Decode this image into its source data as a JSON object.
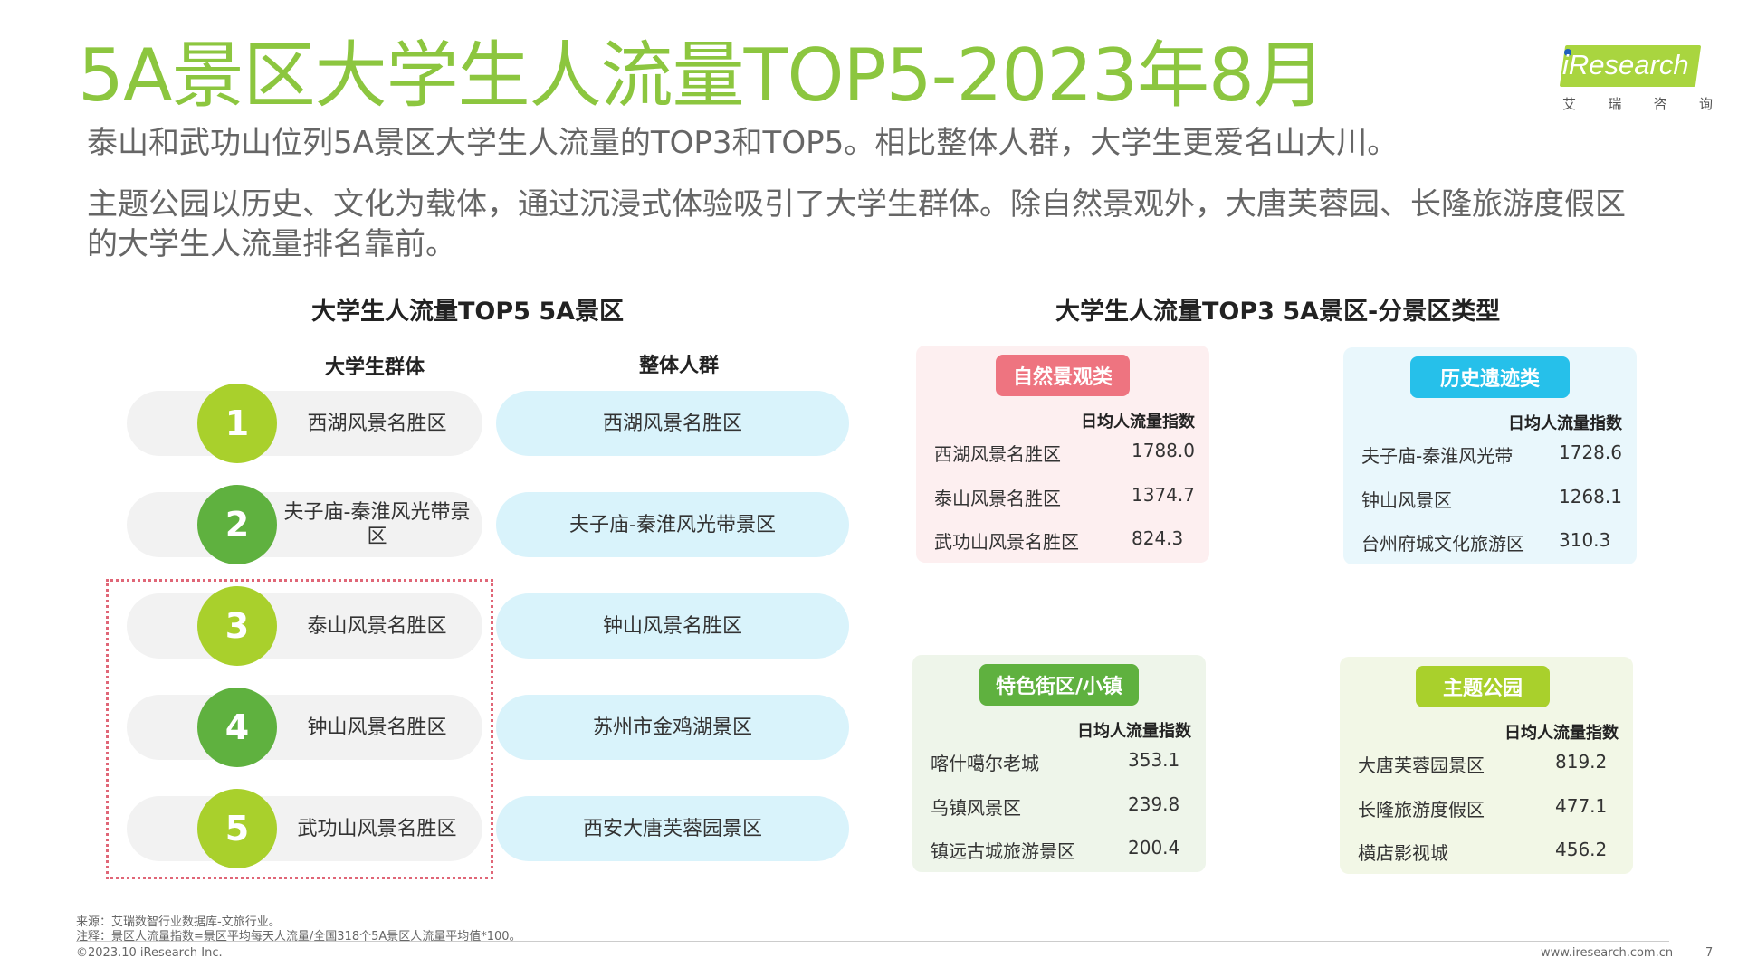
{
  "header": {
    "title": "5A景区大学生人流量TOP5-2023年8月",
    "subtitle_1": "泰山和武功山位列5A景区大学生人流量的TOP3和TOP5。相比整体人群，大学生更爱名山大川。",
    "subtitle_2": "主题公园以历史、文化为载体，通过沉浸式体验吸引了大学生群体。除自然景观外，大唐芙蓉园、长隆旅游度假区的大学生人流量排名靠前。"
  },
  "logo": {
    "text": "iResearch",
    "cn": [
      "艾",
      "瑞",
      "咨",
      "询"
    ]
  },
  "left": {
    "heading": "大学生人流量TOP5 5A景区",
    "col_students": "大学生群体",
    "col_overall": "整体人群",
    "ranks": [
      {
        "rank": "1",
        "student": "西湖风景名胜区",
        "overall": "西湖风景名胜区",
        "color": "#a9d02c"
      },
      {
        "rank": "2",
        "student": "夫子庙-秦淮风光带景区",
        "overall": "夫子庙-秦淮风光带景区",
        "color": "#5fb13f"
      },
      {
        "rank": "3",
        "student": "泰山风景名胜区",
        "overall": "钟山风景名胜区",
        "color": "#a9d02c"
      },
      {
        "rank": "4",
        "student": "钟山风景名胜区",
        "overall": "苏州市金鸡湖景区",
        "color": "#5fb13f"
      },
      {
        "rank": "5",
        "student": "武功山风景名胜区",
        "overall": "西安大唐芙蓉园景区",
        "color": "#a9d02c"
      }
    ]
  },
  "right": {
    "heading": "大学生人流量TOP3 5A景区-分景区类型",
    "index_label": "日均人流量指数",
    "cards": [
      {
        "type": "自然景观类",
        "badge_color": "#ee7480",
        "bg": "#fdeff0",
        "rows": [
          {
            "name": "西湖风景名胜区",
            "value": "1788.0"
          },
          {
            "name": "泰山风景名胜区",
            "value": "1374.7"
          },
          {
            "name": "武功山风景名胜区",
            "value": "824.3"
          }
        ]
      },
      {
        "type": "历史遗迹类",
        "badge_color": "#26c0ea",
        "bg": "#e9f7fc",
        "rows": [
          {
            "name": "夫子庙-秦淮风光带",
            "value": "1728.6"
          },
          {
            "name": "钟山风景区",
            "value": "1268.1"
          },
          {
            "name": "台州府城文化旅游区",
            "value": "310.3"
          }
        ]
      },
      {
        "type": "特色街区/小镇",
        "badge_color": "#5fb13f",
        "bg": "#eef5ea",
        "rows": [
          {
            "name": "喀什噶尔老城",
            "value": "353.1"
          },
          {
            "name": "乌镇风景区",
            "value": "239.8"
          },
          {
            "name": "镇远古城旅游景区",
            "value": "200.4"
          }
        ]
      },
      {
        "type": "主题公园",
        "badge_color": "#a9d02c",
        "bg": "#f2f7e6",
        "rows": [
          {
            "name": "大唐芙蓉园景区",
            "value": "819.2"
          },
          {
            "name": "长隆旅游度假区",
            "value": "477.1"
          },
          {
            "name": "横店影视城",
            "value": "456.2"
          }
        ]
      }
    ]
  },
  "footer": {
    "source": "来源：艾瑞数智行业数据库-文旅行业。",
    "note": "注释：景区人流量指数=景区平均每天人流量/全国318个5A景区人流量平均值*100。",
    "copyright": "©2023.10 iResearch Inc.",
    "site": "www.iresearch.com.cn",
    "page": "7"
  }
}
